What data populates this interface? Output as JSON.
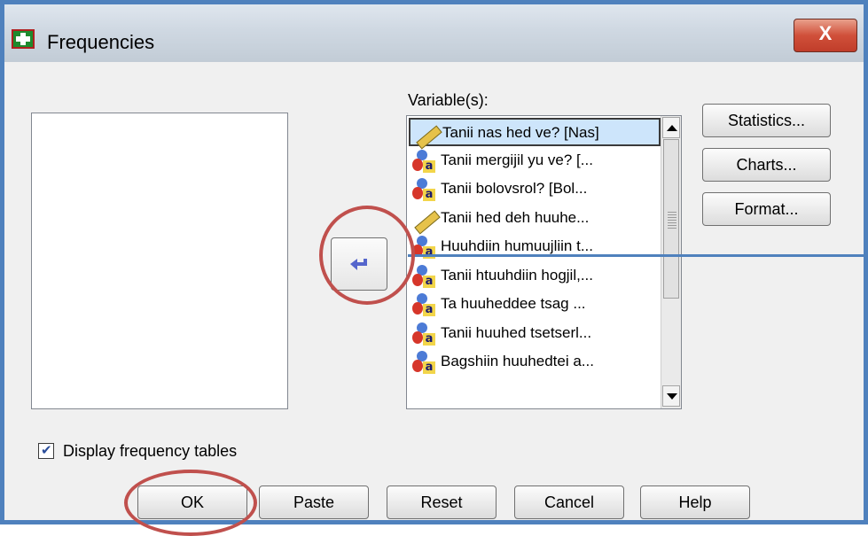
{
  "window": {
    "title": "Frequencies",
    "close_label": "X"
  },
  "variables": {
    "label": "Variable(s):",
    "items": [
      {
        "label": "Tanii nas hed ve? [Nas]",
        "type": "scale",
        "selected": true
      },
      {
        "label": "Tanii mergijil yu ve? [...",
        "type": "nominal"
      },
      {
        "label": "Tanii bolovsrol? [Bol...",
        "type": "nominal"
      },
      {
        "label": "Tanii hed deh huuhe...",
        "type": "scale"
      },
      {
        "label": "Huuhdiin humuujliin t...",
        "type": "nominal"
      },
      {
        "label": "Tanii htuuhdiin hogjil,...",
        "type": "nominal"
      },
      {
        "label": "Ta huuheddee tsag ...",
        "type": "nominal"
      },
      {
        "label": "Tanii huuhed tsetserl...",
        "type": "nominal"
      },
      {
        "label": "Bagshiin huuhedtei a...",
        "type": "nominal"
      }
    ]
  },
  "side_buttons": {
    "statistics": "Statistics...",
    "charts": "Charts...",
    "format": "Format..."
  },
  "options": {
    "display_tables_label": "Display frequency tables",
    "display_tables_checked": true
  },
  "footer": {
    "ok": "OK",
    "paste": "Paste",
    "reset": "Reset",
    "cancel": "Cancel",
    "help": "Help"
  },
  "colors": {
    "accent_border": "#4f81bd",
    "highlight_circle": "#c0504d",
    "close_button": "#c03d2a"
  }
}
